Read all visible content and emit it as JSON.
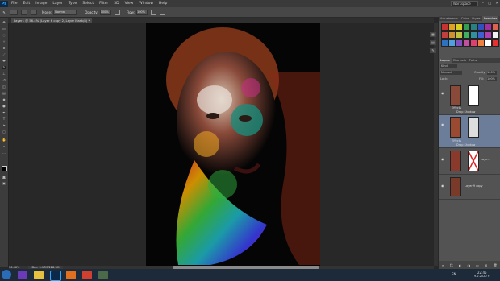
{
  "app": {
    "logo": "Ps"
  },
  "menu": [
    "File",
    "Edit",
    "Image",
    "Layer",
    "Type",
    "Select",
    "Filter",
    "3D",
    "View",
    "Window",
    "Help"
  ],
  "workspace": "Workspace",
  "options": {
    "mode_label": "Mode:",
    "mode_value": "Normal",
    "opacity_label": "Opacity:",
    "opacity_value": "100%",
    "flow_label": "Flow:",
    "flow_value": "100%"
  },
  "doc_tab": "Layer1 @ 56.4% (Layer 6 copy 2, Layer Mask/8) *",
  "status": {
    "zoom": "56.46%",
    "doc": "Doc: 5.17M/228.9M"
  },
  "panels": {
    "top_tabs": [
      "Adjustments",
      "Color",
      "Styles",
      "Swatches"
    ],
    "layers_tabs": [
      "Layers",
      "Channels",
      "Paths"
    ],
    "kind_label": "Kind",
    "blend_mode": "Normal",
    "opacity_label": "Opacity:",
    "opacity_value": "100%",
    "lock_label": "Lock:",
    "fill_label": "Fill:",
    "fill_value": "100%"
  },
  "layers": [
    {
      "name": "Effects",
      "sub": "Drop Shadow"
    },
    {
      "name": "Effects",
      "sub": "Drop Shadow"
    },
    {
      "name": "Laye..."
    },
    {
      "name": "Layer 9 copy"
    }
  ],
  "swatch_colors": [
    "#c83232",
    "#e0a020",
    "#d8d020",
    "#30a050",
    "#2a8080",
    "#3050c0",
    "#a030a0",
    "#e06050",
    "#c04040",
    "#d09030",
    "#c0c040",
    "#40b060",
    "#3090a0",
    "#4060d0",
    "#b040b0",
    "#f0f0f0",
    "#3070c0",
    "#50a0e0",
    "#8050c0",
    "#c050a0",
    "#e04070",
    "#f08040",
    "#ffffff",
    "#e83030"
  ],
  "taskbar": {
    "lang": "EN",
    "time": "22:45",
    "date": "9.2.2020 г."
  }
}
